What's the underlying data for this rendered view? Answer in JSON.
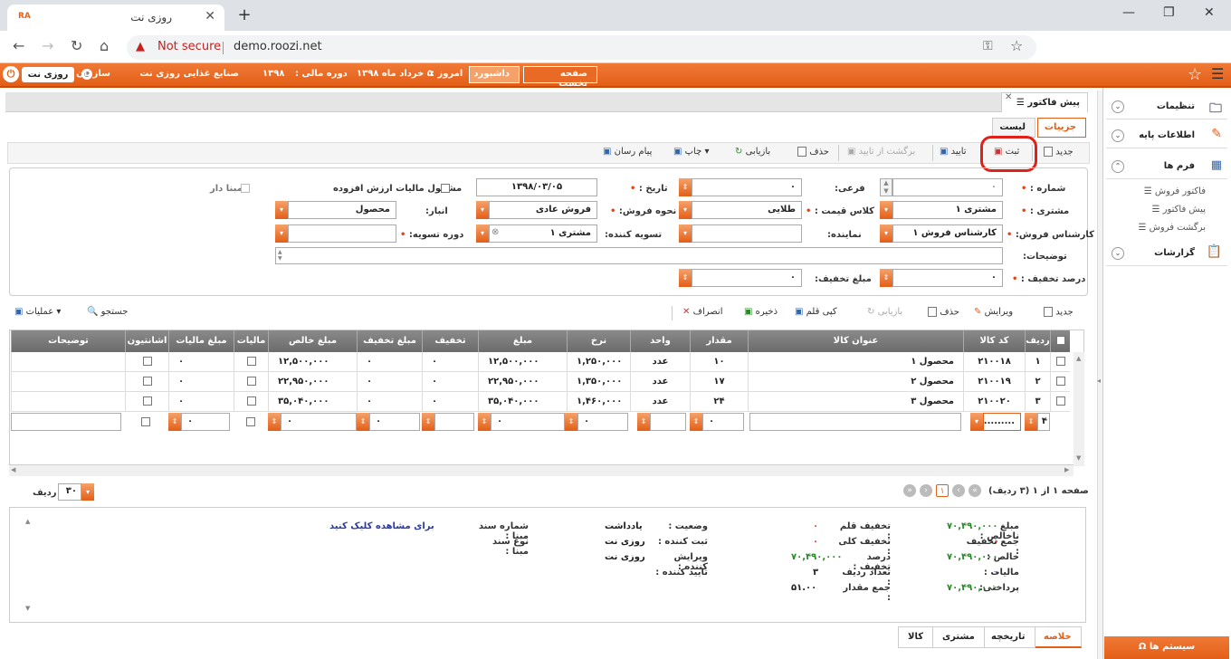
{
  "browser": {
    "tab_title": "روزی نت",
    "favicon_text": "RA",
    "url": "demo.roozi.net",
    "security": "Not secure"
  },
  "topbar": {
    "logo": "روزی نت",
    "org_label": "سازمان :",
    "org_value": "صنایع غذایی روزی نت",
    "fiscal_label": "دوره مالی :",
    "fiscal_value": "۱۳۹۸",
    "today_label": "امروز :",
    "today_value": "۵ خرداد ماه ۱۳۹۸",
    "dashboard": "داشبورد",
    "home": "صفحه نخست"
  },
  "sidebar": {
    "settings": "تنظیمات",
    "base_info": "اطلاعات پایه",
    "forms": "فرم ها",
    "sub_items": [
      "فاکتور فروش",
      "پیش فاکتور",
      "برگشت فروش"
    ],
    "reports": "گزارشات",
    "system": "سیستم ها"
  },
  "page": {
    "tab": "پیش فاکتور",
    "subtab_details": "جزییات",
    "subtab_list": "لیست"
  },
  "toolbar": {
    "new": "جدید",
    "save": "ثبت",
    "approve": "تایید",
    "unapprove": "برگشت از تایید",
    "delete": "حذف",
    "refresh": "بازیابی",
    "print": "چاپ",
    "messenger": "پیام رسان"
  },
  "form": {
    "number_label": "شماره :",
    "number_value": "۰",
    "sub_label": "فرعی:",
    "sub_value": "۰",
    "date_label": "تاریخ :",
    "date_value": "۱۳۹۸/۰۳/۰۵",
    "vat_label": "مشمول مالیات ارزش افزوده",
    "base_label": "مبنا دار",
    "customer_label": "مشتری :",
    "customer_value": "مشتری ۱",
    "price_class_label": "کلاس قیمت :",
    "price_class_value": "طلایی",
    "sale_type_label": "نحوه فروش:",
    "sale_type_value": "فروش عادی",
    "warehouse_label": "انبار:",
    "warehouse_value": "محصول",
    "expert_label": "کارشناس فروش:",
    "expert_value": "کارشناس فروش ۱",
    "agent_label": "نماینده:",
    "settler_label": "تسویه کننده:",
    "settler_value": "مشتری ۱",
    "settle_period_label": "دوره تسویه:",
    "desc_label": "توضیحات:",
    "discount_pct_label": "درصد تخفیف :",
    "discount_pct_value": "۰",
    "discount_amt_label": "مبلغ تخفیف:",
    "discount_amt_value": "۰"
  },
  "gridbar": {
    "new": "جدید",
    "edit": "ویرایش",
    "delete": "حذف",
    "refresh": "بازیابی",
    "copy": "کپی قلم",
    "save": "ذخیره",
    "cancel": "انصراف",
    "search": "جستجو",
    "ops": "عملیات"
  },
  "grid": {
    "headers": [
      "ردیف",
      "کد کالا",
      "عنوان کالا",
      "مقدار",
      "واحد",
      "نرخ",
      "مبلغ",
      "تخفیف درصد",
      "مبلغ تخفیف",
      "مبلغ خالص",
      "مالیات",
      "مبلغ مالیات",
      "اشانتیون",
      "توضیحات"
    ],
    "rows": [
      {
        "row": "۱",
        "code": "۲۱۰۰۱۸",
        "title": "محصول ۱",
        "qty": "۱۰",
        "unit": "عدد",
        "rate": "۱,۲۵۰,۰۰۰",
        "amount": "۱۲,۵۰۰,۰۰۰",
        "dpct": "۰",
        "damt": "۰",
        "net": "۱۲,۵۰۰,۰۰۰",
        "tamt": "۰"
      },
      {
        "row": "۲",
        "code": "۲۱۰۰۱۹",
        "title": "محصول ۲",
        "qty": "۱۷",
        "unit": "عدد",
        "rate": "۱,۳۵۰,۰۰۰",
        "amount": "۲۲,۹۵۰,۰۰۰",
        "dpct": "۰",
        "damt": "۰",
        "net": "۲۲,۹۵۰,۰۰۰",
        "tamt": "۰"
      },
      {
        "row": "۳",
        "code": "۲۱۰۰۲۰",
        "title": "محصول ۳",
        "qty": "۲۴",
        "unit": "عدد",
        "rate": "۱,۴۶۰,۰۰۰",
        "amount": "۳۵,۰۴۰,۰۰۰",
        "dpct": "۰",
        "damt": "۰",
        "net": "۳۵,۰۴۰,۰۰۰",
        "tamt": "۰"
      }
    ],
    "new_row": "۴",
    "new_code": "..........",
    "zero": "۰"
  },
  "pager": {
    "page_info": "صفحه ۱ از ۱ (۳ ردیف)",
    "current_page": "۱",
    "rows_per_page_label": "تعداد ردیف",
    "rows_per_page": "۳۰"
  },
  "summary": {
    "gross_label": "مبلغ ناخالص :",
    "gross": "۷۰,۴۹۰,۰۰۰",
    "total_disc_label": "جمع تخفیف :",
    "total_disc": "۰",
    "net_label": "خالص :",
    "net": "۷۰,۴۹۰,۰۰۰",
    "tax_label": "مالیات :",
    "tax": "۰",
    "payable_label": "پرداختی:",
    "payable": "۷۰,۴۹۰,۰۰۰",
    "item_disc_label": "تخفیف قلم :",
    "item_disc": "۰",
    "overall_disc_label": "تخفیف کلی :",
    "overall_disc": "۰",
    "disc_pct_label": "درصد تخفیف :",
    "disc_pct": "۷۰,۴۹۰,۰۰۰",
    "row_count_label": "تعداد ردیف :",
    "row_count": "۳",
    "qty_total_label": "جمع مقدار :",
    "qty_total": "۵۱.۰۰",
    "status_label": "وضعیت :",
    "status": "یادداشت",
    "creator_label": "ثبت کننده :",
    "creator": "روزی نت",
    "editor_label": "ویرایش کننده :",
    "editor": "روزی نت",
    "approver_label": "تایید کننده :",
    "base_no_label": "شماره سند مبنا :",
    "base_no": "برای مشاهده کلیک کنید",
    "base_type_label": "نوع سند مبنا :"
  },
  "bottom_tabs": [
    "خلاصه",
    "تاریخچه",
    "مشتری",
    "کالا"
  ]
}
